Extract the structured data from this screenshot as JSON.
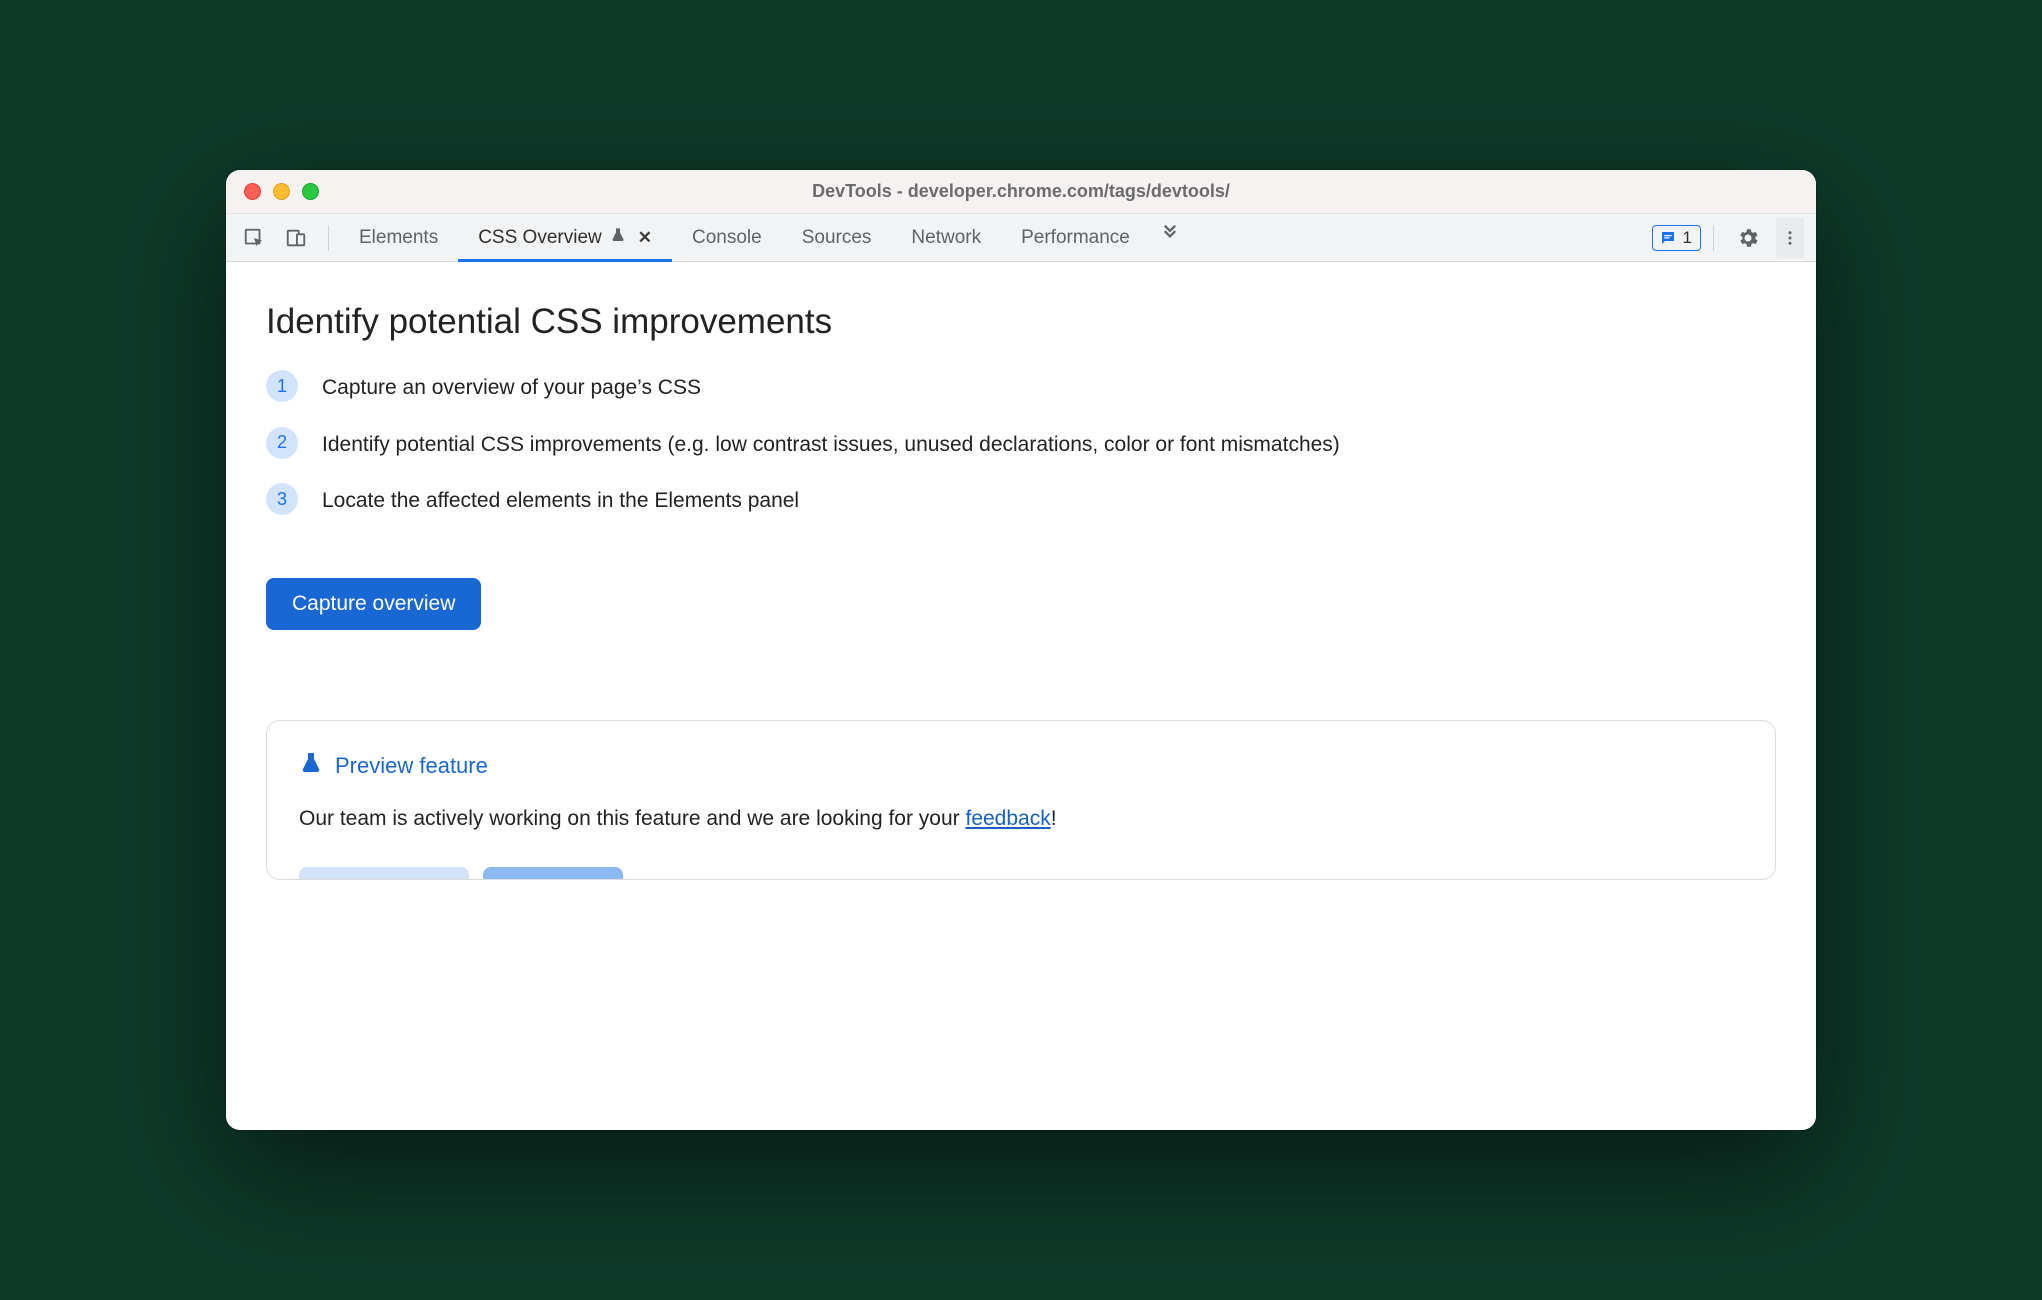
{
  "window": {
    "title": "DevTools - developer.chrome.com/tags/devtools/"
  },
  "tabs": {
    "items": [
      {
        "label": "Elements"
      },
      {
        "label": "CSS Overview"
      },
      {
        "label": "Console"
      },
      {
        "label": "Sources"
      },
      {
        "label": "Network"
      },
      {
        "label": "Performance"
      }
    ],
    "active_index": 1
  },
  "toolbar": {
    "issues_count": "1"
  },
  "main": {
    "heading": "Identify potential CSS improvements",
    "steps": [
      {
        "n": "1",
        "text": "Capture an overview of your page’s CSS"
      },
      {
        "n": "2",
        "text": "Identify potential CSS improvements (e.g. low contrast issues, unused declarations, color or font mismatches)"
      },
      {
        "n": "3",
        "text": "Locate the affected elements in the Elements panel"
      }
    ],
    "capture_button": "Capture overview"
  },
  "preview": {
    "title": "Preview feature",
    "text_before": "Our team is actively working on this feature and we are looking for your ",
    "link": "feedback",
    "text_after": "!"
  }
}
